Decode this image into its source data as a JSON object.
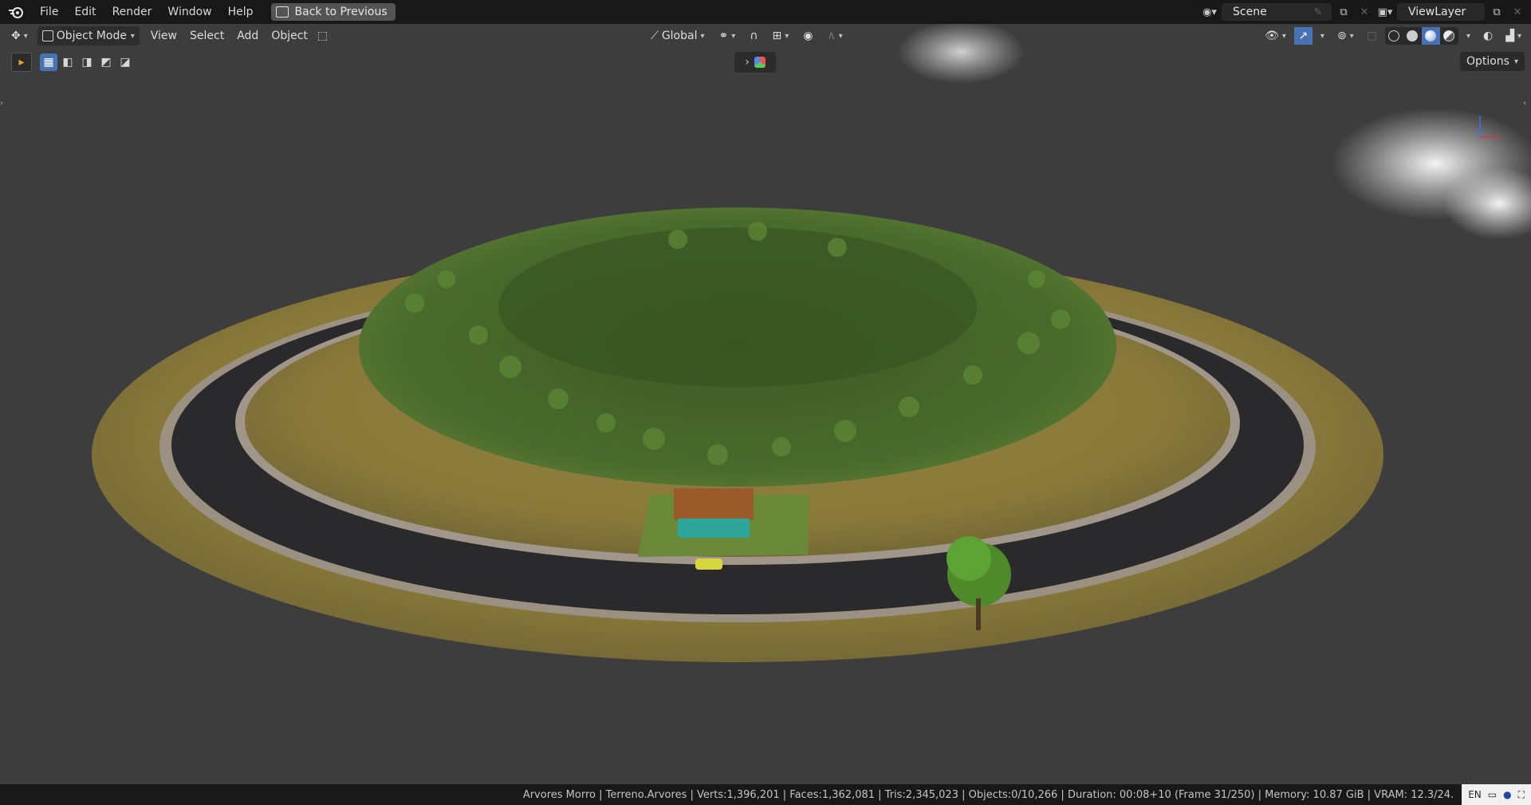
{
  "topbar": {
    "menu": [
      "File",
      "Edit",
      "Render",
      "Window",
      "Help"
    ],
    "back_label": "Back to Previous",
    "scene": "Scene",
    "view_layer": "ViewLayer"
  },
  "viewport_header": {
    "mode": "Object Mode",
    "menus": [
      "View",
      "Select",
      "Add",
      "Object"
    ],
    "transform_orientation": "Global",
    "options_label": "Options",
    "viewport_shading_active": "material-preview"
  },
  "status": {
    "collection": "Arvores Morro",
    "object": "Terreno.Arvores",
    "verts": "Verts:1,396,201",
    "faces": "Faces:1,362,081",
    "tris": "Tris:2,345,023",
    "objects": "Objects:0/10,266",
    "duration": "Duration: 00:08+10 (Frame 31/250)",
    "memory": "Memory: 10.87 GiB",
    "vram": "VRAM: 12.3/24."
  },
  "tray": {
    "lang": "EN"
  },
  "colors": {
    "accent": "#4772b3",
    "viewport_bg": "#3d3d3d",
    "bar_bg": "#181818"
  }
}
